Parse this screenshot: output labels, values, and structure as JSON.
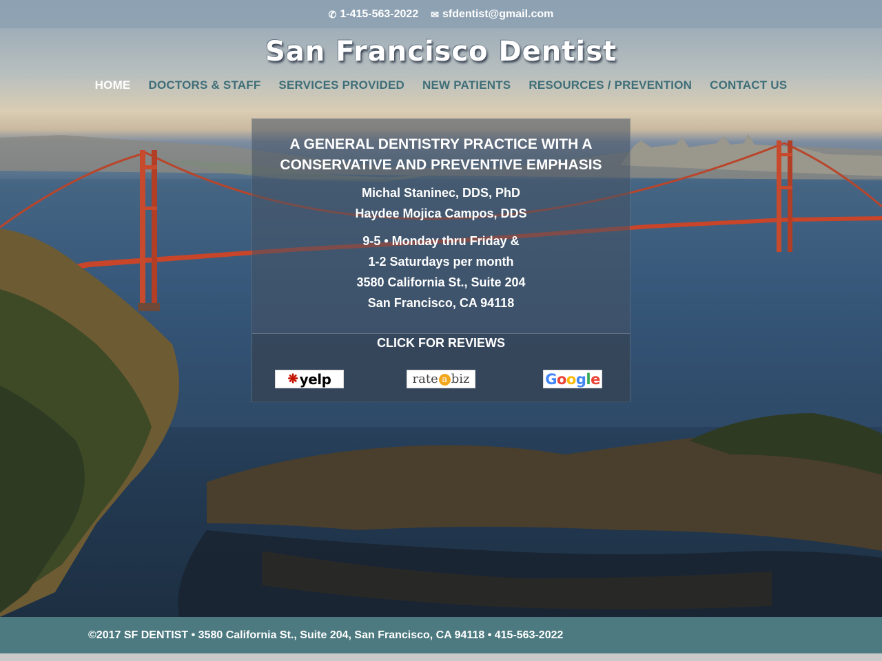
{
  "topbar": {
    "phone": "1-415-563-2022",
    "email": "sfdentist@gmail.com",
    "phone_icon": "phone-icon",
    "email_icon": "envelope-icon"
  },
  "site": {
    "logo": "San Francisco Dentist"
  },
  "nav": {
    "items": [
      {
        "label": "HOME",
        "active": true
      },
      {
        "label": "DOCTORS & STAFF"
      },
      {
        "label": "SERVICES PROVIDED"
      },
      {
        "label": "NEW PATIENTS"
      },
      {
        "label": "RESOURCES / PREVENTION"
      },
      {
        "label": "CONTACT US"
      }
    ]
  },
  "panel": {
    "heading_line1": "A GENERAL DENTISTRY PRACTICE WITH A",
    "heading_line2": "CONSERVATIVE AND PREVENTIVE EMPHASIS",
    "doctors": [
      "Michal Staninec, DDS, PhD",
      "Haydee Mojica Campos, DDS"
    ],
    "hours_line1": "9-5 • Monday thru Friday &",
    "hours_line2": "1-2 Saturdays per month",
    "address_line1": "3580 California St., Suite 204",
    "address_line2": "San Francisco, CA 94118",
    "reviews_title": "CLICK FOR REVIEWS",
    "review_sites": {
      "yelp": "yelp",
      "rate_pre": "rate",
      "rate_a": "a",
      "rate_post": "biz",
      "google": "Google"
    }
  },
  "footer": {
    "text": "©2017 SF DENTIST • 3580 California St., Suite 204, San Francisco, CA 94118 • 415-563-2022"
  },
  "colors": {
    "nav_link": "#3f6e78",
    "nav_active": "#ffffff",
    "footer_bg": "#4c7a80",
    "bridge": "#c8452a"
  }
}
